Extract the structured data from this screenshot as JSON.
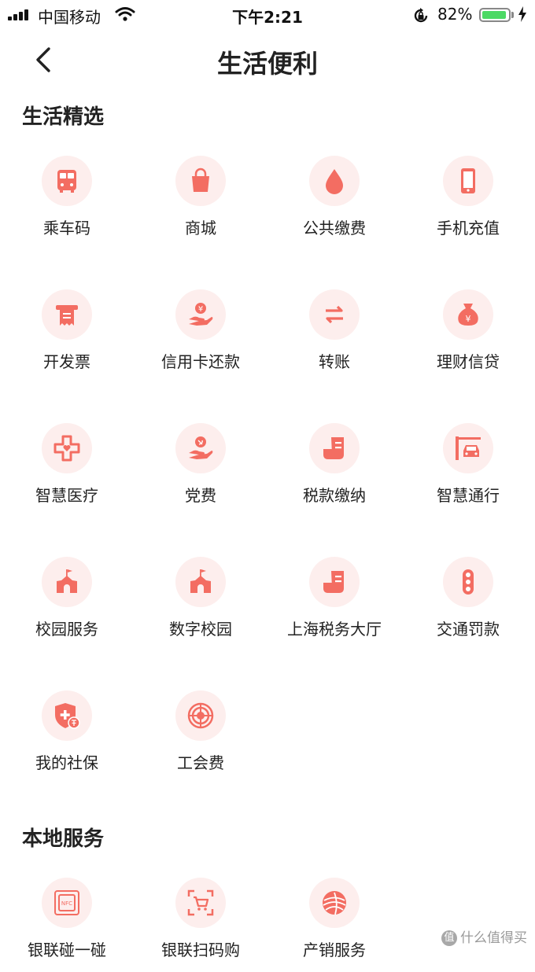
{
  "status_bar": {
    "carrier": "中国移动",
    "time": "下午2:21",
    "battery": "82%",
    "battery_level": 0.82
  },
  "header": {
    "title": "生活便利",
    "back_icon": "chevron-left-icon"
  },
  "colors": {
    "accent": "#f36d62",
    "icon_bg": "#fdeeed",
    "battery": "#4cd964"
  },
  "sections": [
    {
      "title": "生活精选",
      "items": [
        {
          "label": "乘车码",
          "icon": "bus-icon"
        },
        {
          "label": "商城",
          "icon": "shopping-bag-icon"
        },
        {
          "label": "公共缴费",
          "icon": "water-drop-icon"
        },
        {
          "label": "手机充值",
          "icon": "phone-icon"
        },
        {
          "label": "开发票",
          "icon": "invoice-icon"
        },
        {
          "label": "信用卡还款",
          "icon": "hand-coin-icon"
        },
        {
          "label": "转账",
          "icon": "transfer-arrows-icon"
        },
        {
          "label": "理财信贷",
          "icon": "money-bag-icon"
        },
        {
          "label": "智慧医疗",
          "icon": "medical-cross-icon"
        },
        {
          "label": "党费",
          "icon": "hand-party-icon"
        },
        {
          "label": "税款缴纳",
          "icon": "tax-document-icon"
        },
        {
          "label": "智慧通行",
          "icon": "car-gate-icon"
        },
        {
          "label": "校园服务",
          "icon": "school-building-icon"
        },
        {
          "label": "数字校园",
          "icon": "school-building-icon"
        },
        {
          "label": "上海税务大厅",
          "icon": "tax-document-icon"
        },
        {
          "label": "交通罚款",
          "icon": "traffic-light-icon"
        },
        {
          "label": "我的社保",
          "icon": "social-security-shield-icon"
        },
        {
          "label": "工会费",
          "icon": "union-emblem-icon"
        }
      ]
    },
    {
      "title": "本地服务",
      "items": [
        {
          "label": "银联碰一碰",
          "icon": "nfc-icon"
        },
        {
          "label": "银联扫码购",
          "icon": "scan-cart-icon"
        },
        {
          "label": "产销服务",
          "icon": "farm-field-icon"
        }
      ]
    }
  ],
  "watermark": {
    "text": "什么值得买",
    "icon_char": "值"
  }
}
